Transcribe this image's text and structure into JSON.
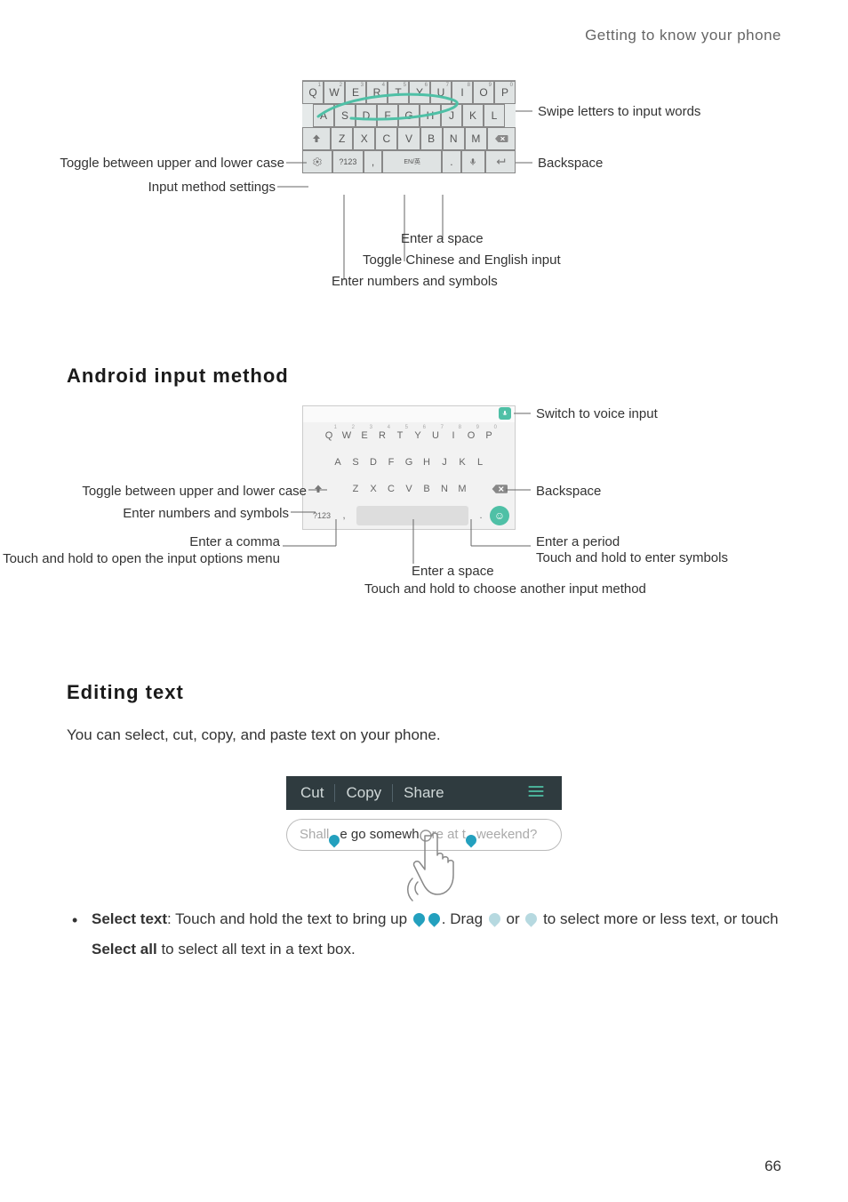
{
  "header": "Getting to know your phone",
  "page_number": "66",
  "diagram1": {
    "rows": {
      "r1": [
        "Q",
        "W",
        "E",
        "R",
        "T",
        "Y",
        "U",
        "I",
        "O",
        "P"
      ],
      "r1_sup": [
        "1",
        "2",
        "3",
        "4",
        "5",
        "6",
        "7",
        "8",
        "9",
        "0"
      ],
      "r2": [
        "A",
        "S",
        "D",
        "F",
        "G",
        "H",
        "J",
        "K",
        "L"
      ],
      "r3_mid": [
        "Z",
        "X",
        "C",
        "V",
        "B",
        "N",
        "M"
      ],
      "sym_key": "?123",
      "lang_key": "EN/英"
    },
    "labels": {
      "swipe": "Swipe letters to input words",
      "toggle_case": "Toggle between upper and lower case",
      "settings": "Input method settings",
      "backspace": "Backspace",
      "enter_space": "Enter a space",
      "toggle_lang": "Toggle Chinese and English input",
      "numbers": "Enter numbers and symbols"
    }
  },
  "heading_android": "Android  input  method",
  "diagram2": {
    "rows": {
      "r1": [
        "Q",
        "W",
        "E",
        "R",
        "T",
        "Y",
        "U",
        "I",
        "O",
        "P"
      ],
      "r1_sup": [
        "1",
        "2",
        "3",
        "4",
        "5",
        "6",
        "7",
        "8",
        "9",
        "0"
      ],
      "r2": [
        "A",
        "S",
        "D",
        "F",
        "G",
        "H",
        "J",
        "K",
        "L"
      ],
      "r3_mid": [
        "Z",
        "X",
        "C",
        "V",
        "B",
        "N",
        "M"
      ],
      "sym_key": "?123",
      "comma": ",",
      "period": "."
    },
    "labels": {
      "voice": "Switch to voice input",
      "toggle_case": "Toggle between upper and lower case",
      "backspace": "Backspace",
      "numbers": "Enter numbers and symbols",
      "comma": "Enter a comma",
      "comma2": "Touch and hold to open the input options menu",
      "period": "Enter a period",
      "period2": "Touch and hold to enter symbols",
      "space": "Enter a space",
      "space2": "Touch and hold to choose another input method"
    }
  },
  "heading_editing": "Editing  text",
  "editing_body": "You can select, cut, copy, and paste text on your phone.",
  "editshot": {
    "context": {
      "cut": "Cut",
      "copy": "Copy",
      "share": "Share"
    },
    "text_pre": "Shall ",
    "text_sel": "e go somewh",
    "text_mid": "re at t",
    "text_post": " weekend?"
  },
  "bullet": {
    "select_text_label": "Select text",
    "part1": ": Touch and hold the text to bring up ",
    "part2": ". Drag ",
    "part3": " or ",
    "part4": " to select more or less text, or touch ",
    "select_all": "Select all",
    "part5": " to select all text in a text box."
  }
}
